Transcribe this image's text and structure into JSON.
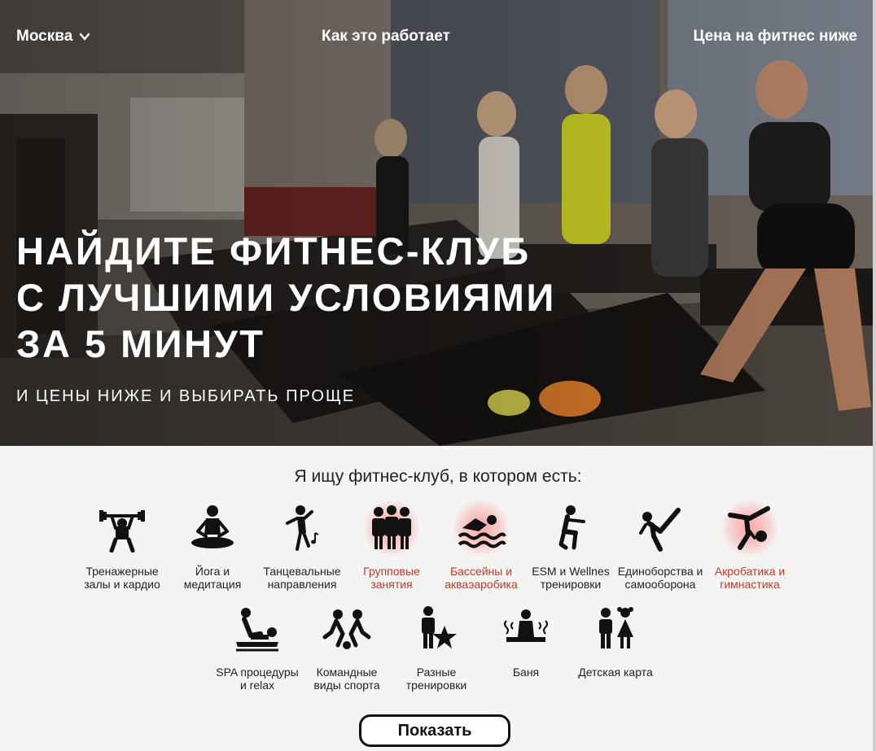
{
  "nav": {
    "city": "Москва",
    "how_it_works": "Как это работает",
    "price_lower": "Цена на фитнес ниже"
  },
  "hero": {
    "title_lines": [
      "НАЙДИТЕ ФИТНЕС-КЛУБ",
      "С ЛУЧШИМИ УСЛОВИЯМИ",
      "ЗА 5 МИНУТ"
    ],
    "subtitle": "И ЦЕНЫ НИЖЕ И ВЫБИРАТЬ ПРОЩЕ"
  },
  "filter": {
    "heading": "Я ищу фитнес-клуб, в котором есть:",
    "categories": [
      {
        "label": "Тренажерные\nзалы и кардио",
        "icon": "weightlifter-icon",
        "selected": true
      },
      {
        "label": "Йога и\nмедитация",
        "icon": "yoga-icon",
        "selected": false
      },
      {
        "label": "Танцевальные\nнаправления",
        "icon": "dancer-icon",
        "selected": false
      },
      {
        "label": "Групповые\nзанятия",
        "icon": "group-icon",
        "selected": true
      },
      {
        "label": "Бассейны и\nакваэаробика",
        "icon": "swimmer-icon",
        "selected": true
      },
      {
        "label": "ESM и Wellnes\nтренировки",
        "icon": "squat-icon",
        "selected": false
      },
      {
        "label": "Единоборства и\nсамооборона",
        "icon": "martial-arts-icon",
        "selected": false
      },
      {
        "label": "Акробатика и\nгимнастика",
        "icon": "gymnast-icon",
        "selected": true
      },
      {
        "label": "SPA процедуры\nи relax",
        "icon": "massage-icon",
        "selected": false
      },
      {
        "label": "Командные\nвиды спорта",
        "icon": "team-sport-icon",
        "selected": false
      },
      {
        "label": "Разные\nтренировки",
        "icon": "trainer-star-icon",
        "selected": false
      },
      {
        "label": "Баня",
        "icon": "sauna-icon",
        "selected": false
      },
      {
        "label": "Детская карта",
        "icon": "kids-icon",
        "selected": false
      }
    ],
    "show_button": "Показать"
  },
  "colors": {
    "accent_selected": "#c0392b",
    "glow": "#ff4a4a",
    "text": "#222222",
    "background": "#f4f4f2"
  }
}
